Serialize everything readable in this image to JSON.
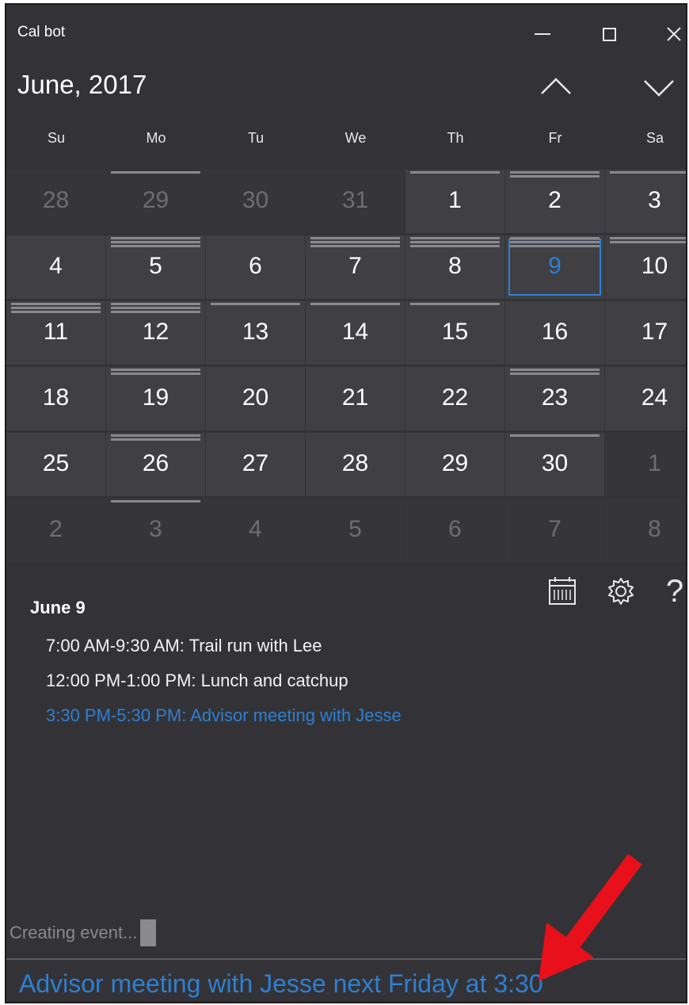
{
  "window": {
    "title": "Cal bot"
  },
  "header": {
    "month": "June, 2017"
  },
  "weekdays": [
    "Su",
    "Mo",
    "Tu",
    "We",
    "Th",
    "Fr",
    "Sa"
  ],
  "weeks": [
    [
      {
        "d": "28",
        "out": true,
        "bars": 0
      },
      {
        "d": "29",
        "out": true,
        "bars": 1
      },
      {
        "d": "30",
        "out": true,
        "bars": 0
      },
      {
        "d": "31",
        "out": true,
        "bars": 0
      },
      {
        "d": "1",
        "out": false,
        "bars": 1
      },
      {
        "d": "2",
        "out": false,
        "bars": 2
      },
      {
        "d": "3",
        "out": false,
        "bars": 1
      }
    ],
    [
      {
        "d": "4",
        "out": false,
        "bars": 0
      },
      {
        "d": "5",
        "out": false,
        "bars": 3
      },
      {
        "d": "6",
        "out": false,
        "bars": 0
      },
      {
        "d": "7",
        "out": false,
        "bars": 3
      },
      {
        "d": "8",
        "out": false,
        "bars": 3
      },
      {
        "d": "9",
        "out": false,
        "bars": 3,
        "today": true
      },
      {
        "d": "10",
        "out": false,
        "bars": 2
      }
    ],
    [
      {
        "d": "11",
        "out": false,
        "bars": 3
      },
      {
        "d": "12",
        "out": false,
        "bars": 3
      },
      {
        "d": "13",
        "out": false,
        "bars": 1
      },
      {
        "d": "14",
        "out": false,
        "bars": 1
      },
      {
        "d": "15",
        "out": false,
        "bars": 1
      },
      {
        "d": "16",
        "out": false,
        "bars": 0
      },
      {
        "d": "17",
        "out": false,
        "bars": 0
      }
    ],
    [
      {
        "d": "18",
        "out": false,
        "bars": 0
      },
      {
        "d": "19",
        "out": false,
        "bars": 2
      },
      {
        "d": "20",
        "out": false,
        "bars": 0
      },
      {
        "d": "21",
        "out": false,
        "bars": 0
      },
      {
        "d": "22",
        "out": false,
        "bars": 0
      },
      {
        "d": "23",
        "out": false,
        "bars": 2
      },
      {
        "d": "24",
        "out": false,
        "bars": 0
      }
    ],
    [
      {
        "d": "25",
        "out": false,
        "bars": 0
      },
      {
        "d": "26",
        "out": false,
        "bars": 2
      },
      {
        "d": "27",
        "out": false,
        "bars": 0
      },
      {
        "d": "28",
        "out": false,
        "bars": 0
      },
      {
        "d": "29",
        "out": false,
        "bars": 0
      },
      {
        "d": "30",
        "out": false,
        "bars": 1
      },
      {
        "d": "1",
        "out": true,
        "bars": 0
      }
    ],
    [
      {
        "d": "2",
        "out": true,
        "bars": 0
      },
      {
        "d": "3",
        "out": true,
        "bars": 1
      },
      {
        "d": "4",
        "out": true,
        "bars": 0
      },
      {
        "d": "5",
        "out": true,
        "bars": 0
      },
      {
        "d": "6",
        "out": true,
        "bars": 0
      },
      {
        "d": "7",
        "out": true,
        "bars": 0
      },
      {
        "d": "8",
        "out": true,
        "bars": 0
      }
    ]
  ],
  "toolbar": {
    "icons": [
      "calendar-icon",
      "gear-icon",
      "help-icon"
    ],
    "help_glyph": "?"
  },
  "day_view": {
    "heading": "June 9",
    "events": [
      "7:00 AM-9:30 AM: Trail run with Lee",
      "12:00 PM-1:00 PM: Lunch and catchup",
      "3:30 PM-5:30 PM: Advisor meeting with Jesse"
    ],
    "highlighted_event": 2
  },
  "status": {
    "text": "Creating event..."
  },
  "command": {
    "value": "Advisor meeting with Jesse next Friday at 3:30"
  },
  "colors": {
    "accent": "#2f7fd1",
    "background": "#333337",
    "arrow": "#e8101a"
  }
}
